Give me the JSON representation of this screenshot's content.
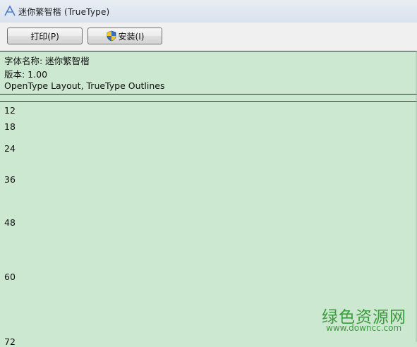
{
  "window": {
    "title": "迷你繁智楷 (TrueType)"
  },
  "toolbar": {
    "print_label": "打印(P)",
    "install_label": "安装(I)"
  },
  "info": {
    "font_name": "字体名称: 迷你繁智楷",
    "version": "版本: 1.00",
    "features": "OpenType Layout, TrueType Outlines"
  },
  "sizes": [
    "12",
    "18",
    "24",
    "36",
    "48",
    "60",
    "72"
  ],
  "watermark": {
    "text": "绿色资源网",
    "url": "www.downcc.com"
  },
  "colors": {
    "background": "#cde8d0",
    "watermark": "#3a9b3c",
    "toolbar": "#f0f0f0"
  }
}
